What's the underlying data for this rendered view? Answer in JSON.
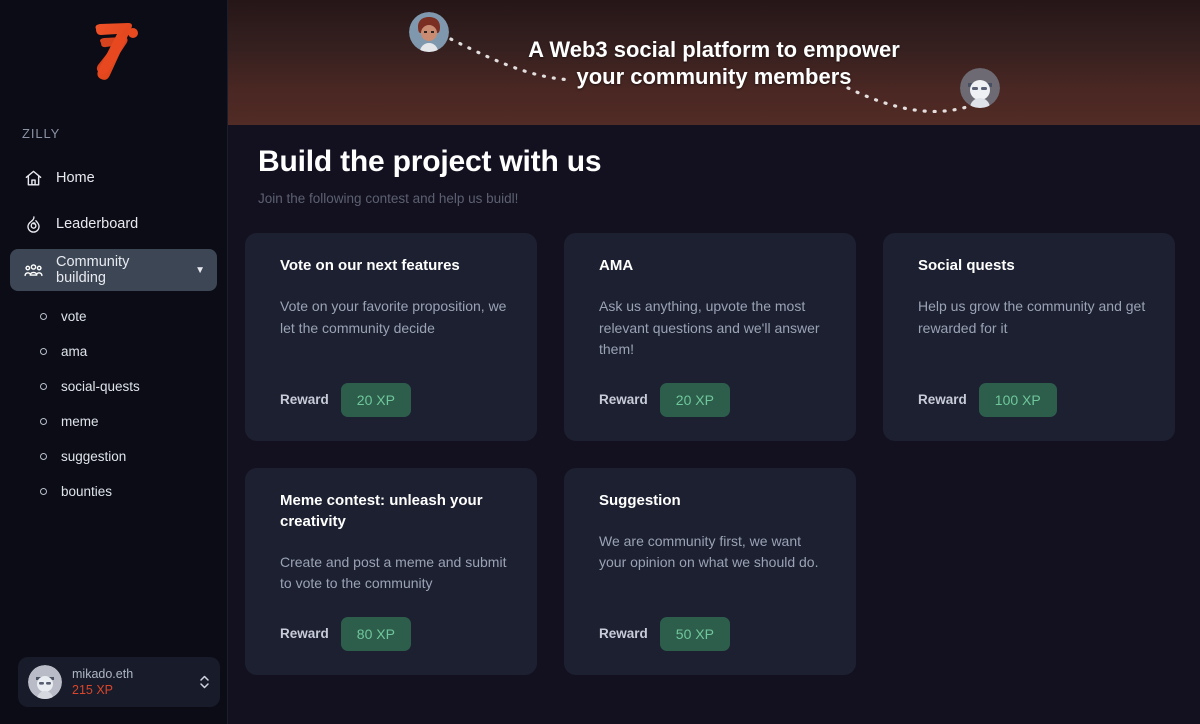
{
  "sidebar": {
    "logo_name": "zilly-logo",
    "brand": "ZILLY",
    "nav": [
      {
        "label": "Home",
        "icon": "home-icon",
        "active": false
      },
      {
        "label": "Leaderboard",
        "icon": "flame-icon",
        "active": false
      },
      {
        "label": "Community building",
        "icon": "people-group-icon",
        "active": true,
        "caret": "▼"
      }
    ],
    "sub_items": [
      {
        "label": "vote"
      },
      {
        "label": "ama"
      },
      {
        "label": "social-quests"
      },
      {
        "label": "meme"
      },
      {
        "label": "suggestion"
      },
      {
        "label": "bounties"
      }
    ],
    "user": {
      "name": "mikado.eth",
      "xp": "215 XP",
      "avatar_name": "user-avatar",
      "switch_icon": "chevron-up-down-icon"
    }
  },
  "banner": {
    "headline_line1": "A Web3 social platform to empower",
    "headline_line2": "your community members",
    "avatar_left_name": "banner-avatar-left",
    "avatar_right_name": "banner-avatar-right"
  },
  "page": {
    "title": "Build the project with us",
    "subtitle": "Join the following contest and help us buidl!"
  },
  "cards": [
    {
      "title": "Vote on our next features",
      "desc": "Vote on your favorite proposition, we let the community decide",
      "reward_label": "Reward",
      "reward_value": "20 XP"
    },
    {
      "title": "AMA",
      "desc": "Ask us anything, upvote the most relevant questions and we'll answer them!",
      "reward_label": "Reward",
      "reward_value": "20 XP"
    },
    {
      "title": "Social quests",
      "desc": "Help us grow the community and get rewarded for it",
      "reward_label": "Reward",
      "reward_value": "100 XP"
    },
    {
      "title": "Meme contest: unleash your creativity",
      "desc": "Create and post a meme and submit to vote to the community",
      "reward_label": "Reward",
      "reward_value": "80 XP"
    },
    {
      "title": "Suggestion",
      "desc": "We are community first, we want your opinion on what we should do.",
      "reward_label": "Reward",
      "reward_value": "50 XP"
    }
  ],
  "colors": {
    "page_bg": "#131120",
    "sidebar_bg": "#0b0c15",
    "card_bg": "#1c2031",
    "accent_orange": "#e8491f",
    "xp_badge_bg": "#2d5d4b",
    "xp_badge_text": "#6fc79b",
    "active_nav_bg": "#3c4654",
    "xp_text": "#d8452a"
  }
}
